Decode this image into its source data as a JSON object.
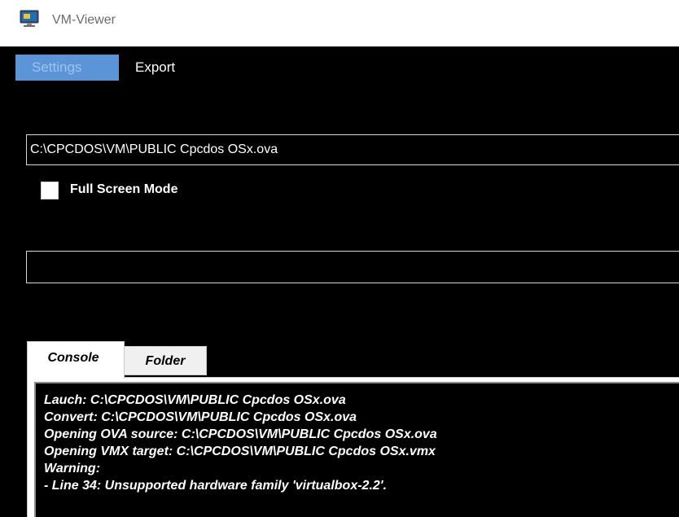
{
  "window": {
    "title": "VM-Viewer",
    "icon": "monitor-app-icon"
  },
  "menu": {
    "items": [
      {
        "label": "Settings",
        "active": true
      },
      {
        "label": "Export",
        "active": false
      }
    ]
  },
  "source_path": {
    "value": "C:\\CPCDOS\\VM\\PUBLIC Cpcdos OSx.ova"
  },
  "fullscreen": {
    "label": "Full Screen Mode",
    "checked": false
  },
  "secondary_field": {
    "value": ""
  },
  "tabs": [
    {
      "label": "Console",
      "active": true
    },
    {
      "label": "Folder",
      "active": false
    }
  ],
  "console": {
    "lines": [
      "Lauch: C:\\CPCDOS\\VM\\PUBLIC Cpcdos OSx.ova",
      "Convert: C:\\CPCDOS\\VM\\PUBLIC Cpcdos OSx.ova",
      "Opening OVA source: C:\\CPCDOS\\VM\\PUBLIC Cpcdos OSx.ova",
      "Opening VMX target: C:\\CPCDOS\\VM\\PUBLIC Cpcdos OSx.vmx",
      "Warning:",
      " - Line 34: Unsupported hardware family 'virtualbox-2.2'."
    ]
  },
  "colors": {
    "menu_active_bg": "#5c95d7",
    "menu_active_text": "#9cc4ec",
    "background": "#000000"
  }
}
